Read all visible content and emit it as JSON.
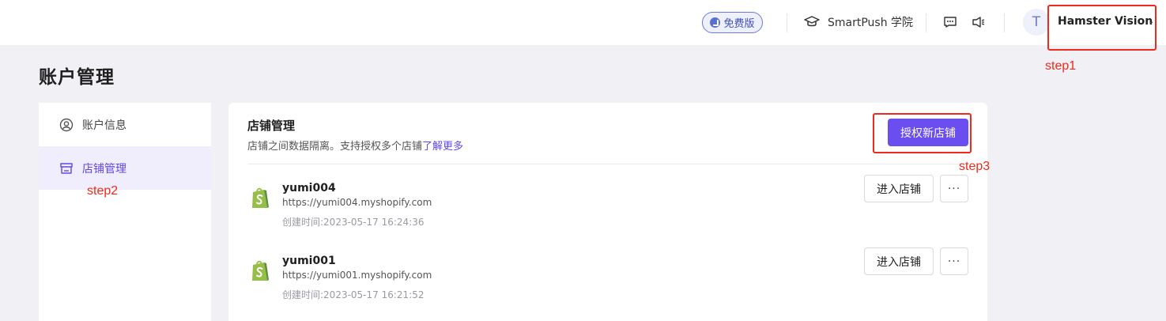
{
  "header": {
    "plan_badge": "免费版",
    "academy_label": "SmartPush 学院",
    "avatar_letter": "T",
    "user_name": "Hamster Vision"
  },
  "page": {
    "title": "账户管理"
  },
  "sidebar": {
    "items": [
      {
        "label": "账户信息",
        "icon": "user-circle-icon",
        "active": false
      },
      {
        "label": "店铺管理",
        "icon": "store-icon",
        "active": true
      }
    ]
  },
  "store_panel": {
    "title": "店铺管理",
    "description": "店铺之间数据隔离。支持授权多个店铺",
    "learn_more": "了解更多",
    "authorize_button": "授权新店铺",
    "stores": [
      {
        "name": "yumi004",
        "url": "https://yumi004.myshopify.com",
        "created": "创建时间:2023-05-17 16:24:36",
        "enter_label": "进入店铺",
        "more_label": "···"
      },
      {
        "name": "yumi001",
        "url": "https://yumi001.myshopify.com",
        "created": "创建时间:2023-05-17 16:21:52",
        "enter_label": "进入店铺",
        "more_label": "···"
      }
    ]
  },
  "annotations": {
    "step1": "step1",
    "step2": "step2",
    "step3": "step3"
  },
  "colors": {
    "accent": "#6a4ef0",
    "annotation": "#ef2a1c",
    "shopify_green": "#95bf47"
  }
}
